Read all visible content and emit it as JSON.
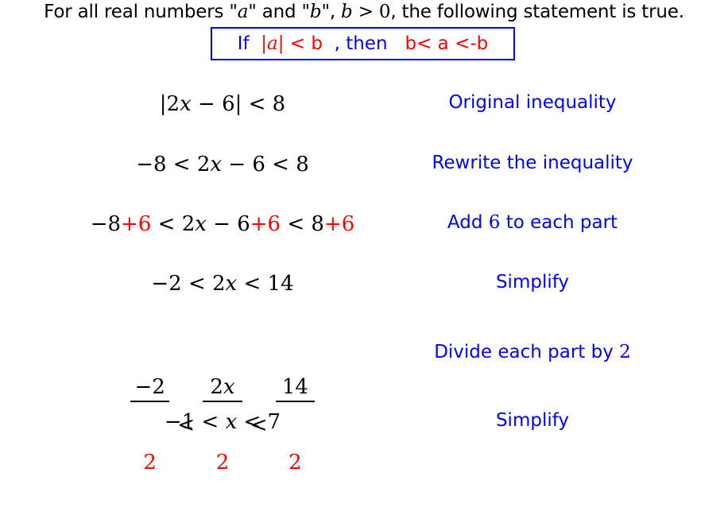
{
  "intro": {
    "text_before_a": "For all real numbers \"",
    "var_a": "a",
    "text_between": "\" and \"",
    "var_b": "b",
    "text_after_b": "\", ",
    "condition_var": "b",
    "condition_rel": " > 0",
    "text_end": ", the following statement is true."
  },
  "rule": {
    "if_label": "If  ",
    "abs_expr": "|a|",
    "premise_rest": " < b ",
    "then_label": " , then   ",
    "conclusion": "b< a <-b"
  },
  "colors": {
    "highlight": "#ff0000",
    "annotation": "#0000ff",
    "text": "#000000"
  },
  "steps": [
    {
      "math_parts": [
        {
          "text": "|2",
          "color": "black"
        },
        {
          "text": "x",
          "color": "black",
          "italic": true
        },
        {
          "text": " − 6| < 8",
          "color": "black"
        }
      ],
      "label": "Original inequality"
    },
    {
      "math_parts": [
        {
          "text": "−8 < 2",
          "color": "black"
        },
        {
          "text": "x",
          "color": "black",
          "italic": true
        },
        {
          "text": " − 6 < 8",
          "color": "black"
        }
      ],
      "label": "Rewrite the inequality"
    },
    {
      "math_parts": [
        {
          "text": "−8",
          "color": "black"
        },
        {
          "text": "+6",
          "color": "red"
        },
        {
          "text": " < 2",
          "color": "black"
        },
        {
          "text": "x",
          "color": "black",
          "italic": true
        },
        {
          "text": " − 6",
          "color": "black"
        },
        {
          "text": "+6",
          "color": "red"
        },
        {
          "text": " < 8",
          "color": "black"
        },
        {
          "text": "+6",
          "color": "red"
        }
      ],
      "label_before": "Add ",
      "label_number": "6",
      "label_after": " to each part"
    },
    {
      "math_parts": [
        {
          "text": "−2 < 2",
          "color": "black"
        },
        {
          "text": "x",
          "color": "black",
          "italic": true
        },
        {
          "text": " < 14",
          "color": "black"
        }
      ],
      "label": "Simplify"
    },
    {
      "fractions": [
        {
          "numerator": "−2",
          "denominator": "2"
        },
        {
          "numerator_coef": "2",
          "numerator_var": "x",
          "denominator": "2"
        },
        {
          "numerator": "14",
          "denominator": "2"
        }
      ],
      "relation": "<",
      "label_before": "Divide each part by ",
      "label_number": "2"
    },
    {
      "math_parts": [
        {
          "text": "−1 < ",
          "color": "black"
        },
        {
          "text": "x",
          "color": "black",
          "italic": true
        },
        {
          "text": " < 7",
          "color": "black"
        }
      ],
      "label": "Simplify"
    }
  ]
}
